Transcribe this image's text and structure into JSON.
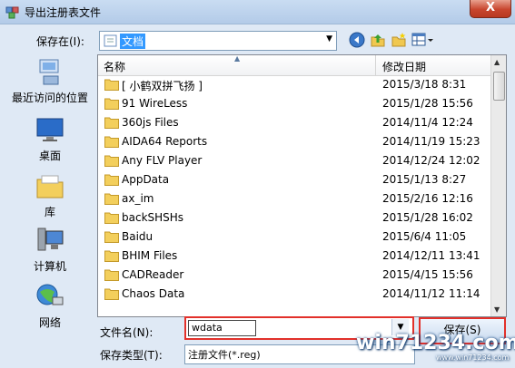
{
  "window": {
    "title": "导出注册表文件",
    "close_label": "X"
  },
  "savein": {
    "label": "保存在(I):",
    "value": "文档"
  },
  "places": [
    {
      "label": "最近访问的位置",
      "icon": "recent-places-icon"
    },
    {
      "label": "桌面",
      "icon": "desktop-icon"
    },
    {
      "label": "库",
      "icon": "libraries-icon"
    },
    {
      "label": "计算机",
      "icon": "computer-icon"
    },
    {
      "label": "网络",
      "icon": "network-icon"
    }
  ],
  "list": {
    "col_name": "名称",
    "col_date": "修改日期",
    "rows": [
      {
        "name": "[ 小鹤双拼飞扬 ]",
        "date": "2015/3/18 8:31"
      },
      {
        "name": "91 WireLess",
        "date": "2015/1/28 15:56"
      },
      {
        "name": "360js Files",
        "date": "2014/11/4 12:24"
      },
      {
        "name": "AIDA64 Reports",
        "date": "2014/11/19 15:23"
      },
      {
        "name": "Any FLV Player",
        "date": "2014/12/24 12:02"
      },
      {
        "name": "AppData",
        "date": "2015/1/13 8:27"
      },
      {
        "name": "ax_im",
        "date": "2015/2/16 12:16"
      },
      {
        "name": "backSHSHs",
        "date": "2015/1/28 16:02"
      },
      {
        "name": "Baidu",
        "date": "2015/6/4 11:05"
      },
      {
        "name": "BHIM Files",
        "date": "2014/12/11 13:41"
      },
      {
        "name": "CADReader",
        "date": "2015/4/15 15:56"
      },
      {
        "name": "Chaos Data",
        "date": "2014/11/12 11:14"
      }
    ]
  },
  "filename": {
    "label": "文件名(N):",
    "value": "wdata"
  },
  "filetype": {
    "label": "保存类型(T):",
    "value": "注册文件(*.reg)"
  },
  "save_button": "保存(S)",
  "watermark": {
    "text": "win71234.com",
    "sub": "www.win71234.com"
  }
}
